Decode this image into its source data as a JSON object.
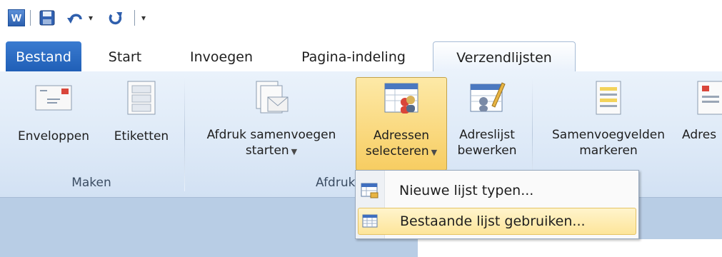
{
  "quick_access": {
    "items": [
      {
        "name": "word-logo-icon",
        "glyph": "W"
      },
      {
        "name": "save-icon"
      },
      {
        "name": "undo-icon"
      },
      {
        "name": "undo-dropdown-arrow",
        "glyph": "▾"
      },
      {
        "name": "redo-icon"
      },
      {
        "name": "customize-qat-icon",
        "glyph": "▾"
      }
    ]
  },
  "tabs": [
    {
      "label": "Bestand",
      "state": "file"
    },
    {
      "label": "Start",
      "state": "normal"
    },
    {
      "label": "Invoegen",
      "state": "normal"
    },
    {
      "label": "Pagina-indeling",
      "state": "normal"
    },
    {
      "label": "Verzendlijsten",
      "state": "active"
    }
  ],
  "ribbon": {
    "groups": [
      {
        "label": "Maken",
        "buttons": [
          {
            "line1": "Enveloppen",
            "line2": "",
            "icon": "envelope-icon"
          },
          {
            "line1": "Etiketten",
            "line2": "",
            "icon": "labels-icon"
          }
        ]
      },
      {
        "label": "Afdruk samen",
        "buttons": [
          {
            "line1": "Afdruk samenvoegen",
            "line2": "starten",
            "dropdown": true,
            "icon": "start-mail-merge-icon"
          },
          {
            "line1": "Adressen",
            "line2": "selecteren",
            "dropdown": true,
            "pressed": true,
            "icon": "select-recipients-icon"
          },
          {
            "line1": "Adreslijst",
            "line2": "bewerken",
            "icon": "edit-recipient-list-icon"
          }
        ]
      },
      {
        "label": "",
        "buttons": [
          {
            "line1": "Samenvoegvelden",
            "line2": "markeren",
            "icon": "highlight-merge-fields-icon"
          },
          {
            "line1": "Adres",
            "line2": "",
            "icon": "address-block-icon"
          }
        ]
      }
    ]
  },
  "dropdown_menu": {
    "items": [
      {
        "label": "Nieuwe lijst typen...",
        "icon": "new-list-icon",
        "hover": false
      },
      {
        "label": "Bestaande lijst gebruiken...",
        "icon": "existing-list-icon",
        "hover": true
      }
    ]
  },
  "colors": {
    "file_tab": "#2a6ac4",
    "ribbon_bg": "#dde9f7",
    "pressed_button": "#f7cd62",
    "menu_hover": "#fde59a",
    "doc_bg": "#b8cde5"
  }
}
